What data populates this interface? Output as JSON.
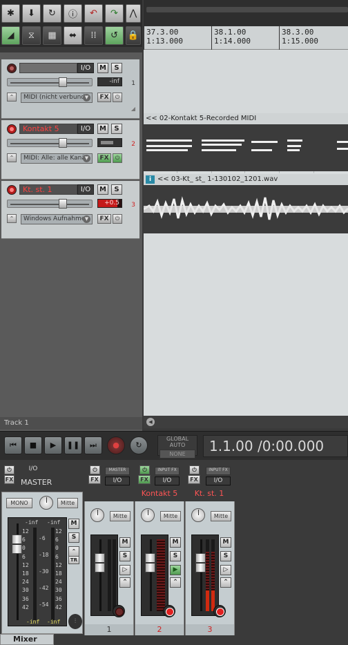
{
  "toolbar": {
    "buttons": [
      "new-project-icon",
      "save-project-icon",
      "reload-icon",
      "project-settings-icon",
      "undo-icon",
      "redo-icon",
      "metronome-icon",
      "snap-icon",
      "ripple-icon",
      "grid-icon",
      "item-lock-icon",
      "move-envelope-icon",
      "crossfade-icon",
      "loop-icon",
      "lock-icon"
    ]
  },
  "ruler": {
    "marks": [
      {
        "bar": "37.3.00",
        "time": "1:13.000"
      },
      {
        "bar": "38.1.00",
        "time": "1:14.000"
      },
      {
        "bar": "38.3.00",
        "time": "1:15.000"
      }
    ]
  },
  "tracks": [
    {
      "num": "1",
      "name": "",
      "io": "I/O",
      "mute": "M",
      "solo": "S",
      "meter": "-inf",
      "input": "MIDI (nicht verbund",
      "fx": "FX",
      "armed": false,
      "fx_on": false
    },
    {
      "num": "2",
      "name": "Kontakt 5",
      "io": "I/O",
      "mute": "M",
      "solo": "S",
      "meter": "",
      "input": "MIDI: Alle: alle Kanä",
      "fx": "FX",
      "armed": true,
      "fx_on": true
    },
    {
      "num": "3",
      "name": "Kt. st. 1",
      "io": "I/O",
      "mute": "M",
      "solo": "S",
      "meter": "+0.5",
      "input": "Windows Aufnahme",
      "fx": "FX",
      "armed": true,
      "fx_on": false
    }
  ],
  "items": {
    "midi": "<< 02-Kontakt 5-Recorded MIDI",
    "audio": "<< 03-Kt_ st_ 1-130102_1201.wav",
    "audio_badge": "i"
  },
  "footer": {
    "track_label": "Track 1"
  },
  "transport": {
    "buttons": [
      "go-start-icon",
      "stop-icon",
      "play-icon",
      "pause-icon",
      "go-end-icon",
      "record-icon",
      "repeat-icon"
    ],
    "global_auto": "GLOBAL AUTO",
    "global_auto_mode": "NONE",
    "time": "1.1.00 /0:00.000"
  },
  "mixer": {
    "tab": "Mixer",
    "master": {
      "name": "MASTER",
      "io": "I/O",
      "fx": "FX",
      "mono": "MONO",
      "pan": "Mitte",
      "mute": "M",
      "solo": "S",
      "tr": "TR",
      "left_peak": "-inf",
      "right_peak": "-inf",
      "scale_left": [
        "12",
        "6",
        "0",
        "6",
        "12",
        "18",
        "24",
        "30",
        "36",
        "42"
      ],
      "scale_mid": [
        "-6",
        "-18",
        "-30",
        "-42",
        "-54"
      ],
      "foot_left": "-inf",
      "foot_right": "-inf"
    },
    "strips": [
      {
        "num": "1",
        "name": "",
        "label": "MASTER",
        "io": "I/O",
        "fx": "FX",
        "pan": "Mitte",
        "mute": "M",
        "solo": "S",
        "armed": false,
        "power": false
      },
      {
        "num": "2",
        "name": "Kontakt 5",
        "label": "INPUT FX",
        "io": "I/O",
        "fx": "FX",
        "pan": "Mitte",
        "mute": "M",
        "solo": "S",
        "armed": true,
        "power": true
      },
      {
        "num": "3",
        "name": "Kt. st. 1",
        "label": "INPUT FX",
        "io": "I/O",
        "fx": "FX",
        "pan": "Mitte",
        "mute": "M",
        "solo": "S",
        "armed": true,
        "power": false
      }
    ]
  },
  "colors": {
    "accent_red": "#ff4040",
    "armed_red": "#d02020",
    "fx_green": "#4e9a4e"
  }
}
